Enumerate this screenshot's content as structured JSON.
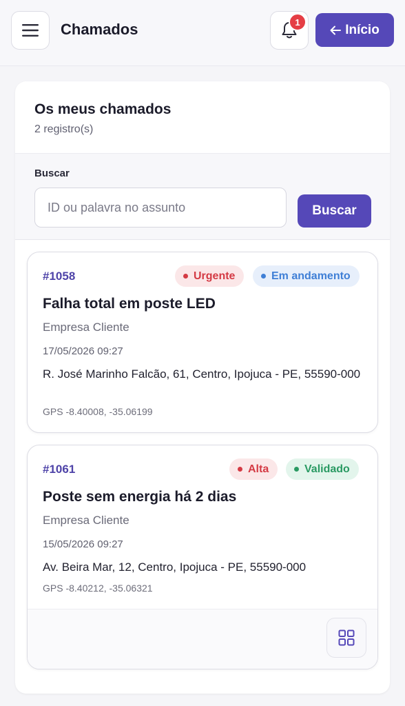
{
  "header": {
    "title": "Chamados",
    "notification_count": "1",
    "home_label": "Início"
  },
  "panel": {
    "title": "Os meus chamados",
    "count": "2 registro(s)"
  },
  "search": {
    "label": "Buscar",
    "placeholder": "ID ou palavra no assunto",
    "value": "",
    "button_label": "Buscar"
  },
  "tickets": [
    {
      "id": "#1058",
      "priority": "Urgente",
      "status": "Em andamento",
      "title": "Falha total em poste LED",
      "company": "Empresa Cliente",
      "date": "17/05/2026 09:27",
      "address": "R. José Marinho Falcão, 61, Centro, Ipojuca - PE, 55590-000",
      "gps": "GPS -8.40008, -35.06199"
    },
    {
      "id": "#1061",
      "priority": "Alta",
      "status": "Validado",
      "title": "Poste sem energia há 2 dias",
      "company": "Empresa Cliente",
      "date": "15/05/2026 09:27",
      "address": "Av. Beira Mar, 12, Centro, Ipojuca - PE, 55590-000",
      "gps": "GPS -8.40212, -35.06321"
    }
  ],
  "icons": {
    "menu": "hamburger-menu-icon",
    "bell": "bell-icon",
    "back": "arrow-left-icon",
    "grid": "grid-icon"
  },
  "colors": {
    "primary": "#5548b8",
    "id_text": "#4e43a8",
    "urgent": "#d43a44",
    "in_progress": "#3f7fd6",
    "validated": "#2a9a63",
    "notification": "#e53e45"
  }
}
